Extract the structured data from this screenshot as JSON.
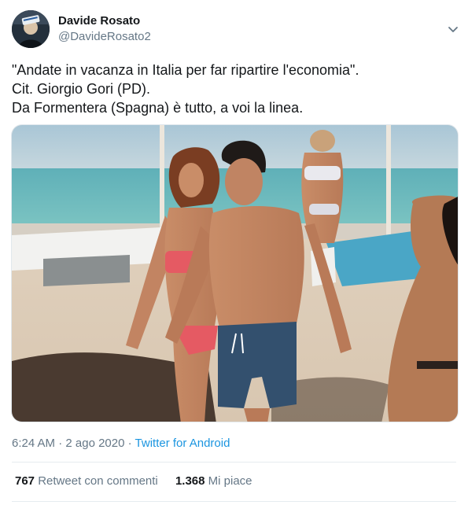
{
  "author": {
    "display_name": "Davide Rosato",
    "handle": "@DavideRosato2"
  },
  "tweet": {
    "lines": [
      "\"Andate in vacanza in Italia per far ripartire l'economia\".",
      "Cit. Giorgio Gori (PD).",
      "Da Formentera (Spagna) è tutto, a voi la linea."
    ]
  },
  "meta": {
    "time": "6:24 AM",
    "separator": "·",
    "date": "2 ago 2020",
    "source": "Twitter for Android"
  },
  "stats": {
    "retweets_count": "767",
    "retweets_label": "Retweet con commenti",
    "likes_count": "1.368",
    "likes_label": "Mi piace"
  },
  "icons": {
    "caret": "chevron-down-icon",
    "avatar": "avatar"
  },
  "colors": {
    "text_primary": "#14171a",
    "text_secondary": "#657786",
    "link": "#1b95e0",
    "divider": "#e6ecf0"
  }
}
